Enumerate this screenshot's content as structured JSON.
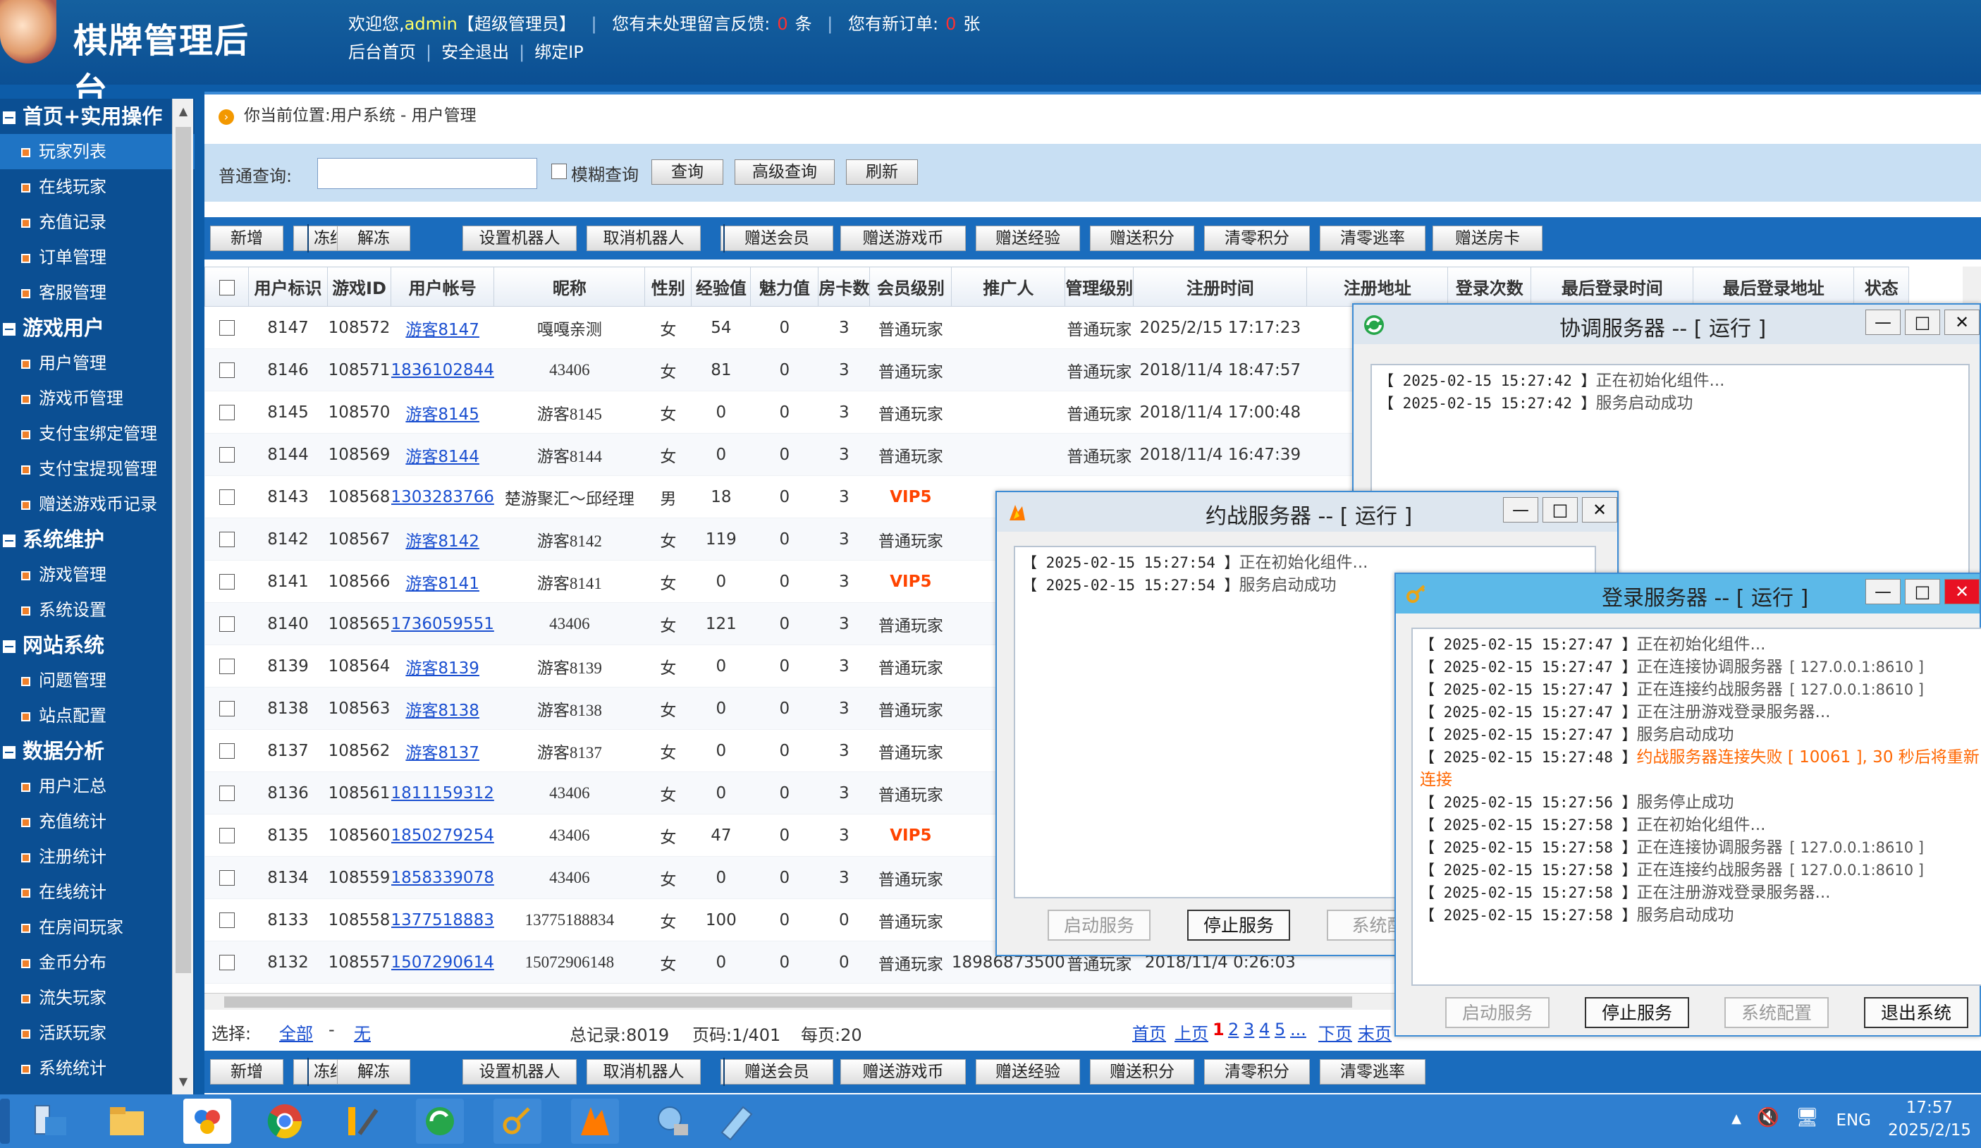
{
  "header": {
    "app_title": "棋牌管理后台",
    "welcome": "欢迎您,",
    "username": "admin",
    "role": "【超级管理员】",
    "feedback_label": "您有未处理留言反馈:",
    "feedback_count": "0",
    "feedback_unit": "条",
    "orders_label": "您有新订单:",
    "orders_count": "0",
    "orders_unit": "张",
    "links": [
      "后台首页",
      "安全退出",
      "绑定IP"
    ]
  },
  "sidebar": {
    "groups": [
      {
        "title": "首页+实用操作",
        "items": [
          "玩家列表",
          "在线玩家",
          "充值记录",
          "订单管理",
          "客服管理"
        ]
      },
      {
        "title": "游戏用户",
        "items": [
          "用户管理",
          "游戏币管理",
          "支付宝绑定管理",
          "支付宝提现管理",
          "赠送游戏币记录"
        ]
      },
      {
        "title": "系统维护",
        "items": [
          "游戏管理",
          "系统设置"
        ]
      },
      {
        "title": "网站系统",
        "items": [
          "问题管理",
          "站点配置"
        ]
      },
      {
        "title": "数据分析",
        "items": [
          "用户汇总",
          "充值统计",
          "注册统计",
          "在线统计",
          "在房间玩家",
          "金币分布",
          "流失玩家",
          "活跃玩家",
          "系统统计"
        ]
      }
    ],
    "active_item": "玩家列表"
  },
  "breadcrumb": "你当前位置:用户系统 - 用户管理",
  "search": {
    "label": "普通查询:",
    "value": "",
    "fuzzy_label": "模糊查询",
    "buttons": [
      "查询",
      "高级查询",
      "刷新"
    ]
  },
  "toolbar": {
    "buttons": [
      "新增",
      "冻结",
      "解冻",
      "设置机器人",
      "取消机器人",
      "赠送会员",
      "赠送游戏币",
      "赠送经验",
      "赠送积分",
      "清零积分",
      "清零逃率",
      "赠送房卡"
    ]
  },
  "table": {
    "columns": [
      "用户标识",
      "游戏ID",
      "用户帐号",
      "昵称",
      "性别",
      "经验值",
      "魅力值",
      "房卡数",
      "会员级别",
      "推广人",
      "管理级别",
      "注册时间",
      "注册地址",
      "登录次数",
      "最后登录时间",
      "最后登录地址",
      "状态"
    ],
    "rows": [
      [
        "8147",
        "108572",
        "游客8147",
        "嘎嘎亲测",
        "女",
        "54",
        "0",
        "3",
        "普通玩家",
        "",
        "普通玩家",
        "2025/2/15 17:17:23"
      ],
      [
        "8146",
        "108571",
        "1836102844",
        "43406",
        "女",
        "81",
        "0",
        "3",
        "普通玩家",
        "",
        "普通玩家",
        "2018/11/4 18:47:57"
      ],
      [
        "8145",
        "108570",
        "游客8145",
        "游客8145",
        "女",
        "0",
        "0",
        "3",
        "普通玩家",
        "",
        "普通玩家",
        "2018/11/4 17:00:48"
      ],
      [
        "8144",
        "108569",
        "游客8144",
        "游客8144",
        "女",
        "0",
        "0",
        "3",
        "普通玩家",
        "",
        "普通玩家",
        "2018/11/4 16:47:39"
      ],
      [
        "8143",
        "108568",
        "1303283766",
        "楚游聚汇～邱经理",
        "男",
        "18",
        "0",
        "3",
        "VIP5",
        "",
        "",
        ""
      ],
      [
        "8142",
        "108567",
        "游客8142",
        "游客8142",
        "女",
        "119",
        "0",
        "3",
        "普通玩家",
        "",
        "",
        ""
      ],
      [
        "8141",
        "108566",
        "游客8141",
        "游客8141",
        "女",
        "0",
        "0",
        "3",
        "VIP5",
        "",
        "",
        ""
      ],
      [
        "8140",
        "108565",
        "1736059551",
        "43406",
        "女",
        "121",
        "0",
        "3",
        "普通玩家",
        "",
        "",
        ""
      ],
      [
        "8139",
        "108564",
        "游客8139",
        "游客8139",
        "女",
        "0",
        "0",
        "3",
        "普通玩家",
        "",
        "",
        ""
      ],
      [
        "8138",
        "108563",
        "游客8138",
        "游客8138",
        "女",
        "0",
        "0",
        "3",
        "普通玩家",
        "",
        "",
        ""
      ],
      [
        "8137",
        "108562",
        "游客8137",
        "游客8137",
        "女",
        "0",
        "0",
        "3",
        "普通玩家",
        "",
        "",
        ""
      ],
      [
        "8136",
        "108561",
        "1811159312",
        "43406",
        "女",
        "0",
        "0",
        "3",
        "普通玩家",
        "",
        "",
        ""
      ],
      [
        "8135",
        "108560",
        "1850279254",
        "43406",
        "女",
        "47",
        "0",
        "3",
        "VIP5",
        "",
        "",
        ""
      ],
      [
        "8134",
        "108559",
        "1858339078",
        "43406",
        "女",
        "0",
        "0",
        "3",
        "普通玩家",
        "",
        "",
        ""
      ],
      [
        "8133",
        "108558",
        "1377518883",
        "13775188834",
        "女",
        "100",
        "0",
        "0",
        "普通玩家",
        "",
        "",
        ""
      ],
      [
        "8132",
        "108557",
        "1507290614",
        "15072906148",
        "女",
        "0",
        "0",
        "0",
        "普通玩家",
        "18986873500",
        "普通玩家",
        "2018/11/4 0:26:03"
      ]
    ]
  },
  "pager": {
    "select_label": "选择:",
    "all": "全部",
    "none": "无",
    "total": "总记录:8019",
    "page": "页码:1/401",
    "per_page": "每页:20",
    "first": "首页",
    "prev": "上页",
    "pages": [
      "1",
      "2",
      "3",
      "4",
      "5",
      "..."
    ],
    "next": "下页",
    "last": "末页"
  },
  "windows": {
    "coord": {
      "title": "协调服务器 -- [ 运行 ]",
      "log": [
        [
          "【 2025-02-15 15:27:42 】",
          "正在初始化组件..."
        ],
        [
          "【 2025-02-15 15:27:42 】",
          "服务启动成功"
        ]
      ]
    },
    "match": {
      "title": "约战服务器 -- [ 运行 ]",
      "log": [
        [
          "【 2025-02-15 15:27:54 】",
          "正在初始化组件..."
        ],
        [
          "【 2025-02-15 15:27:54 】",
          "服务启动成功"
        ]
      ],
      "buttons": [
        "启动服务",
        "停止服务",
        "系统配"
      ]
    },
    "login": {
      "title": "登录服务器 -- [ 运行 ]",
      "log": [
        [
          "【 2025-02-15 15:27:47 】",
          "正在初始化组件...",
          ""
        ],
        [
          "【 2025-02-15 15:27:47 】",
          "正在连接协调服务器",
          "[ 127.0.0.1:8610 ]"
        ],
        [
          "【 2025-02-15 15:27:47 】",
          "正在连接约战服务器",
          "[ 127.0.0.1:8610 ]"
        ],
        [
          "【 2025-02-15 15:27:47 】",
          "正在注册游戏登录服务器...",
          ""
        ],
        [
          "【 2025-02-15 15:27:47 】",
          "服务启动成功",
          ""
        ],
        [
          "【 2025-02-15 15:27:48 】",
          "约战服务器连接失败 [ 10061 ], 30 秒后将重新",
          ""
        ],
        [
          "",
          "连接",
          ""
        ],
        [
          "【 2025-02-15 15:27:56 】",
          "服务停止成功",
          ""
        ],
        [
          "【 2025-02-15 15:27:58 】",
          "正在初始化组件...",
          ""
        ],
        [
          "【 2025-02-15 15:27:58 】",
          "正在连接协调服务器",
          "[ 127.0.0.1:8610 ]"
        ],
        [
          "【 2025-02-15 15:27:58 】",
          "正在连接约战服务器",
          "[ 127.0.0.1:8610 ]"
        ],
        [
          "【 2025-02-15 15:27:58 】",
          "正在注册游戏登录服务器...",
          ""
        ],
        [
          "【 2025-02-15 15:27:58 】",
          "服务启动成功",
          ""
        ]
      ],
      "buttons": [
        "启动服务",
        "停止服务",
        "系统配置",
        "退出系统"
      ]
    }
  },
  "taskbar": {
    "language": "ENG",
    "time": "17:57",
    "date": "2025/2/15"
  }
}
